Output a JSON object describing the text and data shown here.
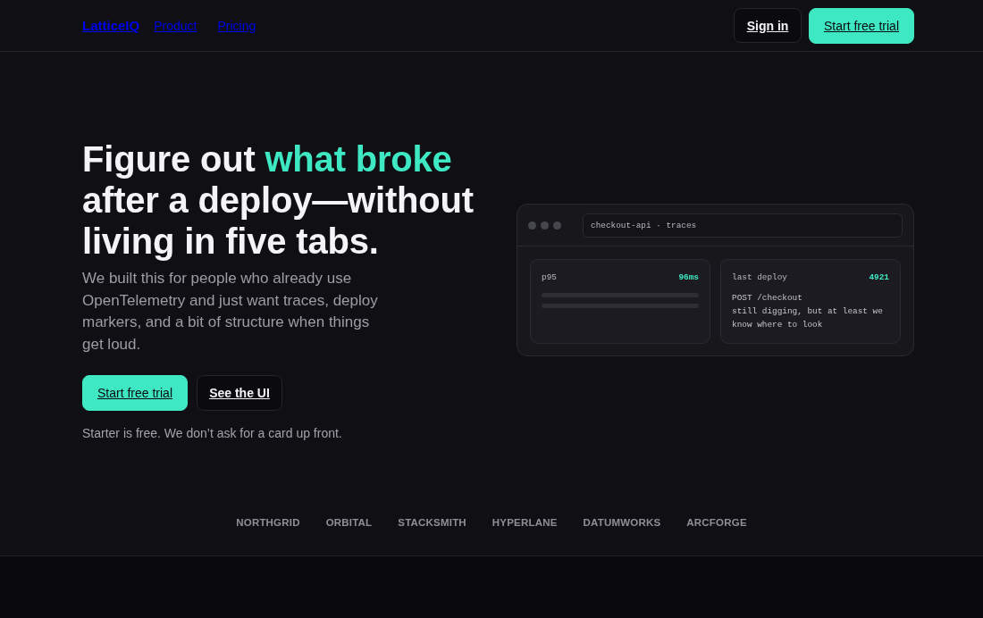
{
  "nav": {
    "logo": "LatticeIQ",
    "links": [
      "Product",
      "Pricing"
    ],
    "buttons": [
      {
        "label": "Sign in",
        "kind": "secondary"
      },
      {
        "label": "Start free trial",
        "kind": "primary"
      }
    ]
  },
  "hero": {
    "headline": [
      {
        "text": "Figure out ",
        "highlighted": false
      },
      {
        "text": "what broke",
        "highlighted": true
      },
      {
        "text": " after a deploy—without living in five tabs.",
        "highlighted": false
      }
    ],
    "description": "We built this for people who already use OpenTelemetry and just want traces, deploy markers, and a bit of structure when things get loud.",
    "buttons": [
      {
        "label": "Start free trial",
        "kind": "primary"
      },
      {
        "label": "See the UI",
        "kind": "secondary"
      }
    ],
    "note": "Starter is free. We don’t ask for a card up front."
  },
  "preview": {
    "address": "checkout-api · traces",
    "cards": [
      {
        "kind": "metric",
        "label": "p95",
        "value": "96ms"
      },
      {
        "kind": "deploy",
        "label": "last deploy",
        "value": "4921",
        "lines": [
          "POST /checkout",
          "still digging, but at least we know where to look"
        ]
      }
    ]
  },
  "logos": [
    "NORTHGRID",
    "ORBITAL",
    "STACKSMITH",
    "HYPERLANE",
    "DATUMWORKS",
    "ARCFORGE"
  ]
}
